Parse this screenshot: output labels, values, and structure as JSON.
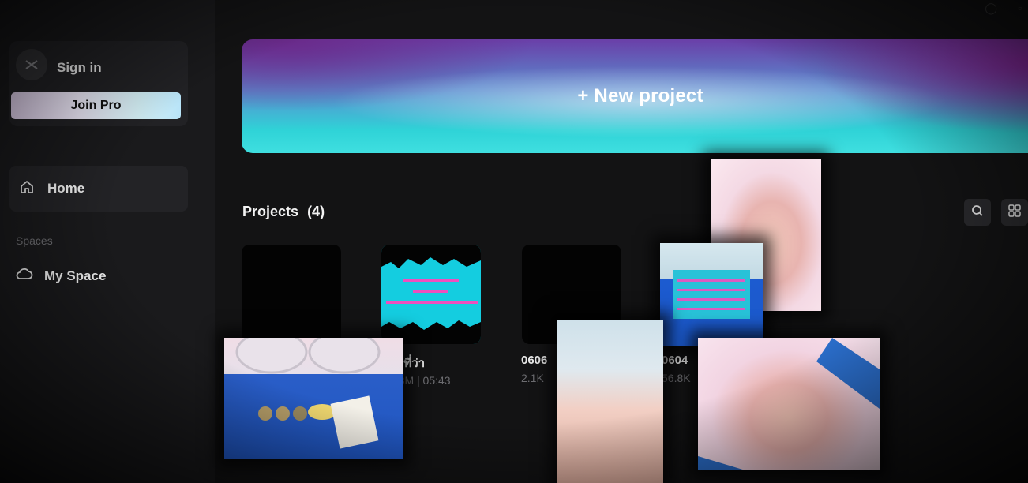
{
  "sidebar": {
    "signin_label": "Sign in",
    "join_pro_label": "Join Pro",
    "home_label": "Home",
    "spaces_label": "Spaces",
    "my_space_label": "My Space"
  },
  "main": {
    "new_project_label": "+ New project",
    "projects_title": "Projects",
    "projects_count": "(4)",
    "projects": [
      {
        "name": "",
        "meta": ""
      },
      {
        "name": "ทำที่ว่า",
        "meta": "3.3M | 05:43"
      },
      {
        "name": "0606",
        "meta": "2.1K"
      },
      {
        "name": "0604",
        "meta": "56.8K"
      }
    ]
  },
  "colors": {
    "background": "#131314",
    "sidebar": "#1a1a1c",
    "accent_teal": "#2fd3d7",
    "accent_purple": "#9b2bb0"
  },
  "icons": [
    "capcut-logo-icon",
    "home-icon",
    "cloud-icon",
    "search-icon",
    "grid-view-icon"
  ]
}
